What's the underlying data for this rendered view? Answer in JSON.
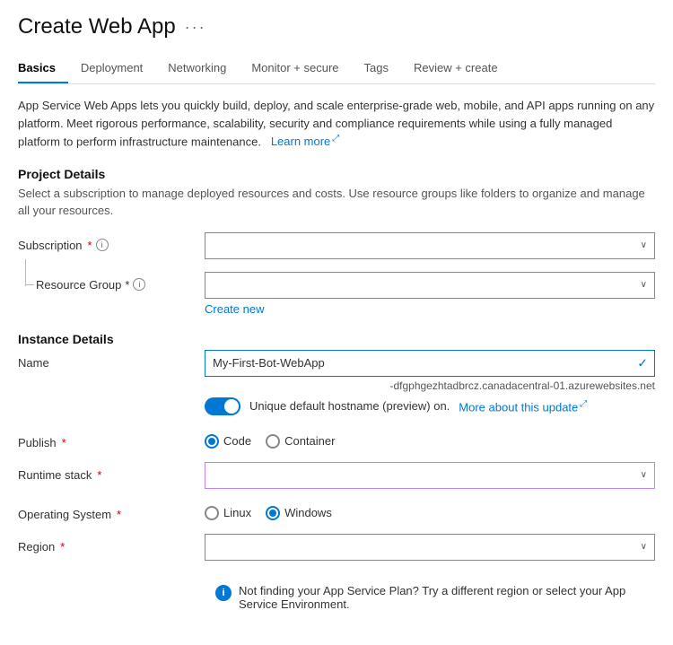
{
  "header": {
    "title": "Create Web App",
    "dots_label": "···"
  },
  "tabs": [
    {
      "id": "basics",
      "label": "Basics",
      "active": true
    },
    {
      "id": "deployment",
      "label": "Deployment",
      "active": false
    },
    {
      "id": "networking",
      "label": "Networking",
      "active": false
    },
    {
      "id": "monitor",
      "label": "Monitor + secure",
      "active": false
    },
    {
      "id": "tags",
      "label": "Tags",
      "active": false
    },
    {
      "id": "review",
      "label": "Review + create",
      "active": false
    }
  ],
  "description": "App Service Web Apps lets you quickly build, deploy, and scale enterprise-grade web, mobile, and API apps running on any platform. Meet rigorous performance, scalability, security and compliance requirements while using a fully managed platform to perform infrastructure maintenance.",
  "learn_more_label": "Learn more",
  "learn_more_ext_icon": "⤢",
  "project_details": {
    "header": "Project Details",
    "description": "Select a subscription to manage deployed resources and costs. Use resource groups like folders to organize and manage all your resources.",
    "subscription": {
      "label": "Subscription",
      "required": true,
      "value": "",
      "placeholder": ""
    },
    "resource_group": {
      "label": "Resource Group",
      "required": true,
      "value": "",
      "placeholder": ""
    },
    "create_new_label": "Create new"
  },
  "instance_details": {
    "header": "Instance Details",
    "name": {
      "label": "Name",
      "value": "My-First-Bot-WebApp",
      "subdomain": "-dfgphgezhtadbrcz.canadacentral-01.azurewebsites.net"
    },
    "toggle": {
      "label_on": "Unique default hostname (preview) on.",
      "link_label": "More about this update",
      "link_ext_icon": "⤢"
    },
    "publish": {
      "label": "Publish",
      "required": true,
      "options": [
        "Code",
        "Container"
      ],
      "selected": "Code"
    },
    "runtime_stack": {
      "label": "Runtime stack",
      "required": true,
      "value": ""
    },
    "operating_system": {
      "label": "Operating System",
      "required": true,
      "options": [
        "Linux",
        "Windows"
      ],
      "selected": "Windows"
    },
    "region": {
      "label": "Region",
      "required": true,
      "value": ""
    },
    "info_notice": "Not finding your App Service Plan? Try a different region or select your App Service Environment."
  },
  "icons": {
    "info": "i",
    "check": "✓",
    "arrow_down": "∨",
    "info_solid": "i"
  }
}
